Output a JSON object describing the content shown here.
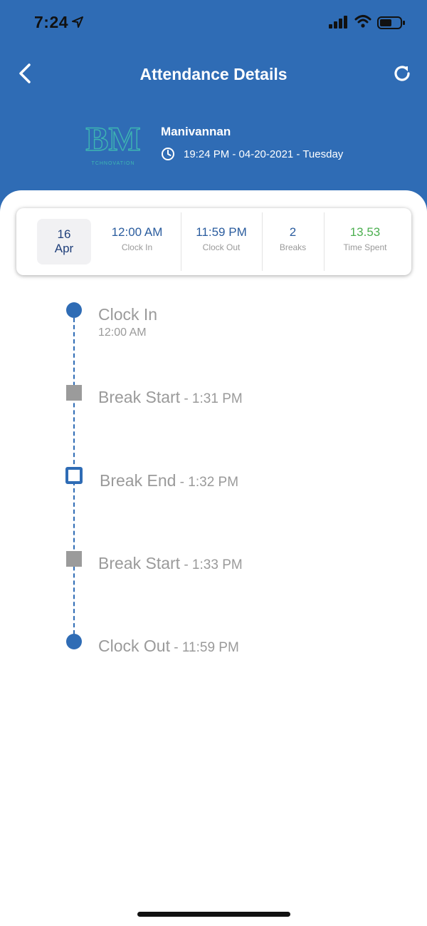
{
  "status_bar": {
    "time": "7:24"
  },
  "header": {
    "title": "Attendance Details"
  },
  "profile": {
    "name": "Manivannan",
    "datetime": "19:24 PM - 04-20-2021 - Tuesday",
    "logo_text": "BM",
    "logo_subtext": "TCHNOVATION"
  },
  "summary": {
    "date_day": "16",
    "date_month": "Apr",
    "clock_in_value": "12:00 AM",
    "clock_in_label": "Clock In",
    "clock_out_value": "11:59 PM",
    "clock_out_label": "Clock Out",
    "breaks_value": "2",
    "breaks_label": "Breaks",
    "time_spent_value": "13.53",
    "time_spent_label": "Time Spent"
  },
  "timeline": [
    {
      "title": "Clock In",
      "time": "",
      "subtitle": "12:00 AM",
      "marker": "circle"
    },
    {
      "title": "Break Start",
      "time": " - 1:31 PM",
      "marker": "square-filled"
    },
    {
      "title": "Break End",
      "time": " - 1:32 PM",
      "marker": "square-outline"
    },
    {
      "title": "Break Start",
      "time": " - 1:33 PM",
      "marker": "square-filled"
    },
    {
      "title": "Clock Out",
      "time": " - 11:59 PM",
      "marker": "circle"
    }
  ],
  "colors": {
    "primary": "#2f6cb5",
    "time_spent": "#4caf50",
    "muted_text": "#9a9a9a",
    "break_marker": "#9b9b9b"
  },
  "icons": {
    "back": "chevron-left-icon",
    "refresh": "refresh-icon",
    "clock": "clock-icon",
    "location": "location-arrow-icon",
    "signal": "cellular-signal-icon",
    "wifi": "wifi-icon",
    "battery": "battery-icon"
  }
}
